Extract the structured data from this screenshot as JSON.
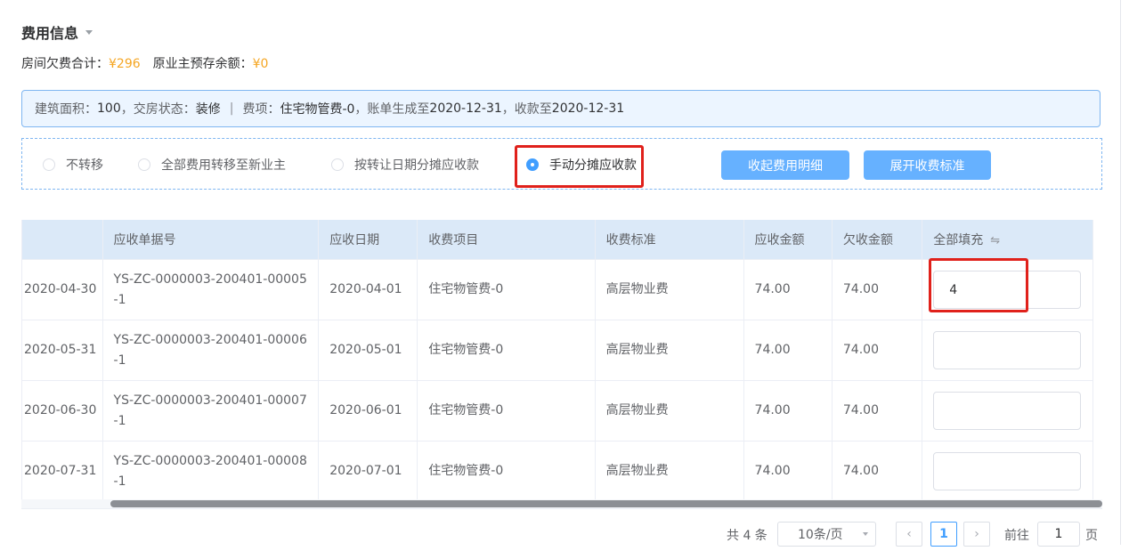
{
  "section": {
    "title": "费用信息"
  },
  "summary": {
    "room_arrears_label": "房间欠费合计：",
    "room_arrears_value": "¥296",
    "prev_owner_balance_label": "原业主预存余额：",
    "prev_owner_balance_value": "¥0"
  },
  "info_bar": {
    "area_label": "建筑面积：",
    "area_value": "100",
    "status_label": "，交房状态：",
    "status_value": "装修",
    "separator": "|",
    "item_label": "费项：",
    "item_value": "住宅物管费-0",
    "bill_label": "，账单生成至",
    "bill_value": "2020-12-31",
    "collect_label": "，收款至",
    "collect_value": "2020-12-31"
  },
  "transfer_options": [
    {
      "label": "不转移",
      "checked": false
    },
    {
      "label": "全部费用转移至新业主",
      "checked": false
    },
    {
      "label": "按转让日期分摊应收款",
      "checked": false
    },
    {
      "label": "手动分摊应收款",
      "checked": true
    }
  ],
  "buttons": {
    "collapse_detail": "收起费用明细",
    "expand_standard": "展开收费标准"
  },
  "table": {
    "headers": {
      "period": "",
      "bill_no": "应收单据号",
      "due_date": "应收日期",
      "fee_item": "收费项目",
      "fee_standard": "收费标准",
      "receivable": "应收金额",
      "arrears": "欠收金额",
      "fill_all": "全部填充"
    },
    "rows": [
      {
        "period": "2020-04-30",
        "bill_no": "YS-ZC-0000003-200401-00005-1",
        "due_date": "2020-04-01",
        "fee_item": "住宅物管费-0",
        "fee_standard": "高层物业费",
        "receivable": "74.00",
        "arrears": "74.00",
        "fill": "4"
      },
      {
        "period": "2020-05-31",
        "bill_no": "YS-ZC-0000003-200401-00006-1",
        "due_date": "2020-05-01",
        "fee_item": "住宅物管费-0",
        "fee_standard": "高层物业费",
        "receivable": "74.00",
        "arrears": "74.00",
        "fill": ""
      },
      {
        "period": "2020-06-30",
        "bill_no": "YS-ZC-0000003-200401-00007-1",
        "due_date": "2020-06-01",
        "fee_item": "住宅物管费-0",
        "fee_standard": "高层物业费",
        "receivable": "74.00",
        "arrears": "74.00",
        "fill": ""
      },
      {
        "period": "2020-07-31",
        "bill_no": "YS-ZC-0000003-200401-00008-1",
        "due_date": "2020-07-01",
        "fee_item": "住宅物管费-0",
        "fee_standard": "高层物业费",
        "receivable": "74.00",
        "arrears": "74.00",
        "fill": ""
      }
    ]
  },
  "pagination": {
    "total": "共 4 条",
    "page_size": "10条/页",
    "current_page": "1",
    "goto_label": "前往",
    "goto_value": "1",
    "page_unit": "页"
  },
  "colors": {
    "accent": "#409eff",
    "button": "#66b1ff",
    "amount": "#f5a623",
    "highlight": "#e0211b",
    "header_bg": "#dbe9f8"
  }
}
